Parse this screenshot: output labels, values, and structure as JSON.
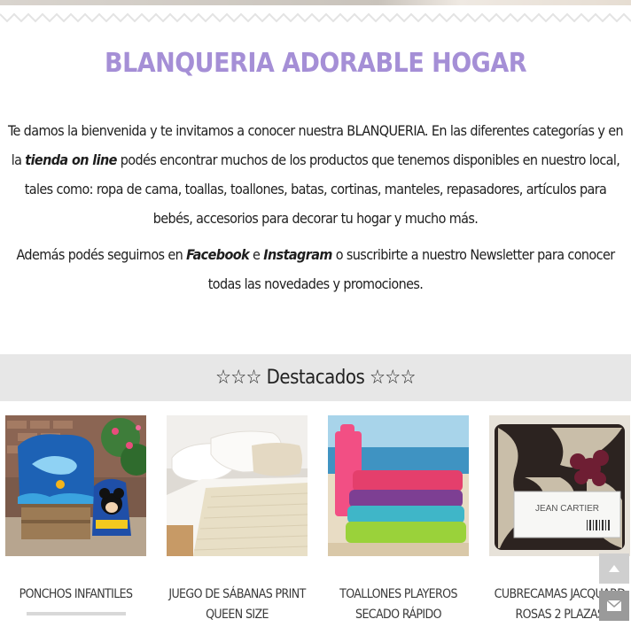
{
  "title": "BLANQUERIA ADORABLE HOGAR",
  "intro": {
    "p1_a": "Te damos la bienvenida y te invitamos a conocer nuestra BLANQUERIA.  En las diferentes categorías y en la ",
    "p1_link": "tienda on line",
    "p1_b": " podés encontrar muchos de los productos que tenemos disponibles en nuestro local, tales como: ropa de cama, toallas, toallones, batas, cortinas, manteles, repasadores, artículos para bebés, accesorios para decorar tu hogar y mucho más.",
    "p2_a": "Además podés seguirnos en ",
    "p2_facebook": "Facebook",
    "p2_mid": " e ",
    "p2_instagram": "Instagram",
    "p2_b": " o suscribirte a nuestro Newsletter para conocer todas las novedades y promociones."
  },
  "featured": {
    "label": "☆☆☆ Destacados ☆☆☆"
  },
  "products": [
    {
      "name": "PONCHOS INFANTILES"
    },
    {
      "name": "JUEGO DE SÁBANAS PRINT QUEEN SIZE"
    },
    {
      "name": "TOALLONES PLAYEROS SECADO RÁPIDO"
    },
    {
      "name": "CUBRECAMAS JACQUARD ROSAS 2 PLAZAS"
    }
  ],
  "product_images": [
    {
      "brand_text": ""
    },
    {
      "brand_text": ""
    },
    {
      "brand_text": ""
    },
    {
      "brand_text": "JEAN CARTIER"
    }
  ],
  "icons": {
    "scroll_top": "chevron-up-icon",
    "mail": "envelope-icon"
  },
  "colors": {
    "title": "#a58fd6",
    "band": "#e7e7e7"
  }
}
